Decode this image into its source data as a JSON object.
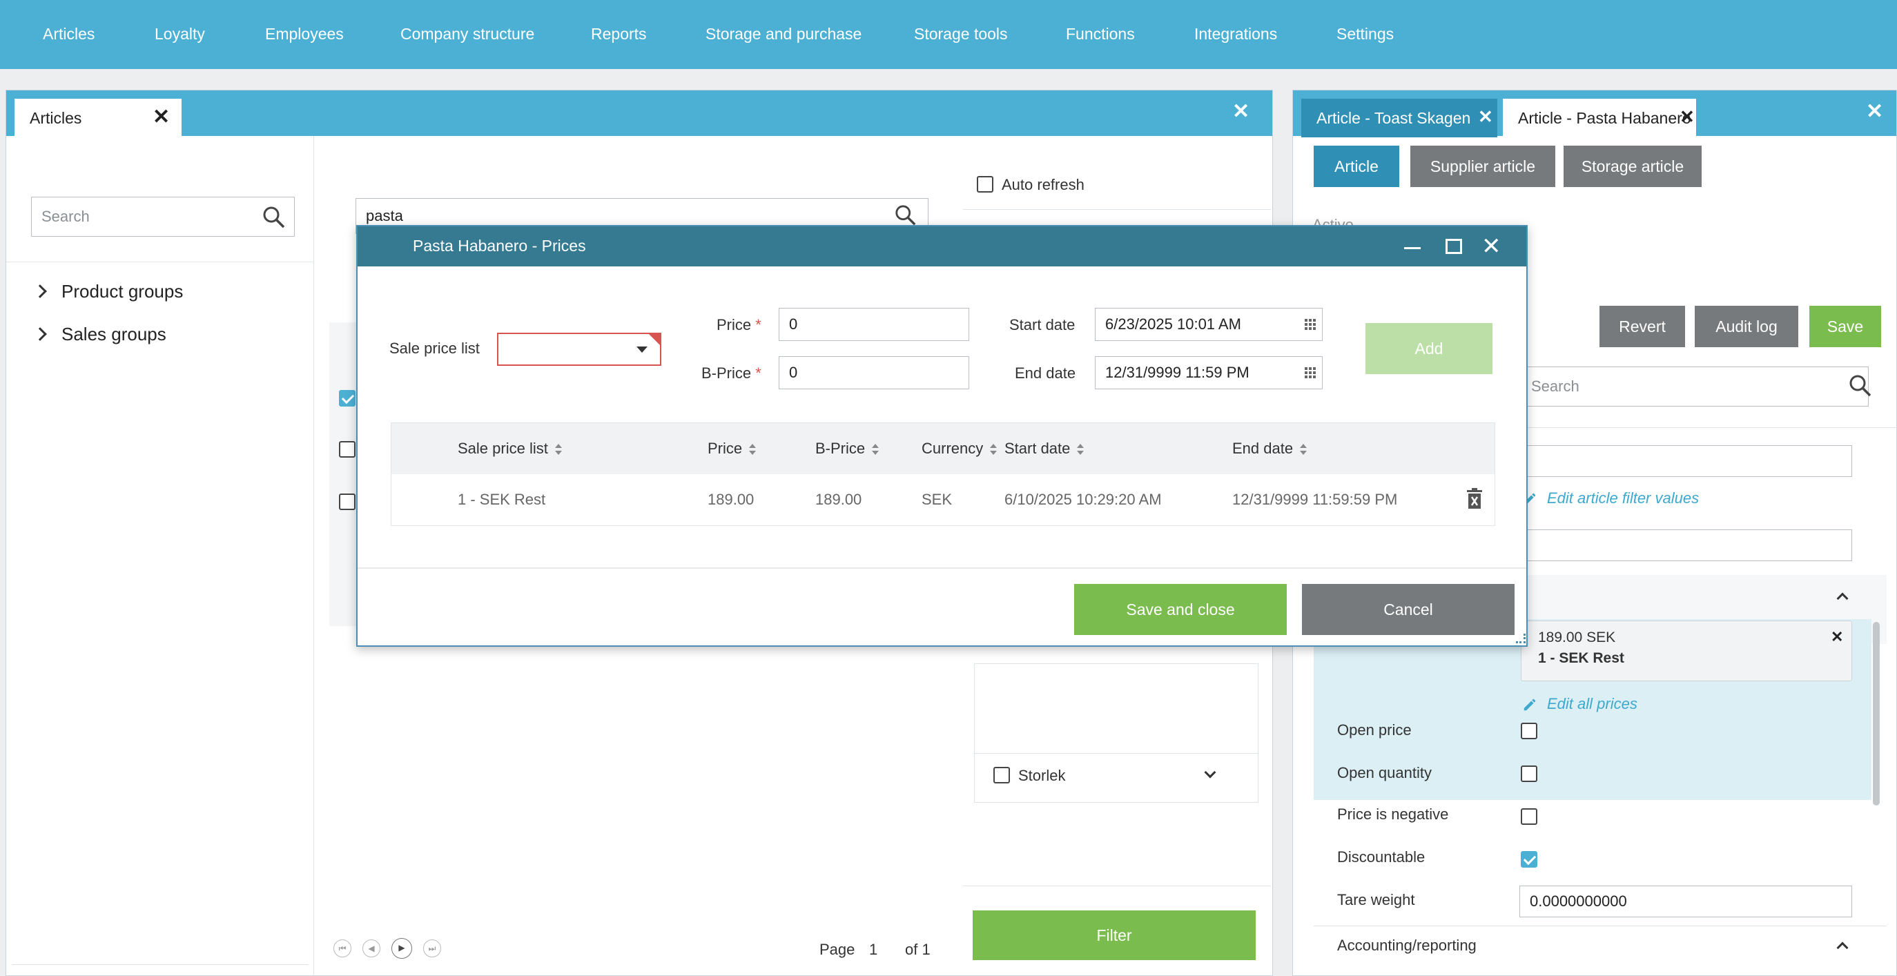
{
  "nav": {
    "items": [
      "Articles",
      "Loyalty",
      "Employees",
      "Company structure",
      "Reports",
      "Storage and purchase",
      "Storage tools",
      "Functions",
      "Integrations",
      "Settings"
    ]
  },
  "left_panel": {
    "tab_label": "Articles",
    "search_placeholder": "Search",
    "tree": [
      "Product groups",
      "Sales groups"
    ],
    "article_search_value": "pasta",
    "auto_refresh_label": "Auto refresh",
    "storlek_label": "Storlek",
    "filter_button": "Filter",
    "pager": {
      "page_label": "Page",
      "page_value": "1",
      "of_label": "of 1"
    }
  },
  "right_panel": {
    "tabs": [
      "Article - Toast Skagen",
      "Article - Pasta Habanero"
    ],
    "subtabs": [
      "Article",
      "Supplier article",
      "Storage article"
    ],
    "active_label": "Active",
    "buttons": {
      "revert": "Revert",
      "audit_log": "Audit log",
      "save": "Save"
    },
    "search_placeholder": "Search",
    "edit_filter_values": "Edit article filter values",
    "price_card": {
      "amount": "189.00 SEK",
      "list": "1 - SEK Rest"
    },
    "edit_all_prices": "Edit all prices",
    "fields": [
      {
        "label": "Open price",
        "checked": false
      },
      {
        "label": "Open quantity",
        "checked": false
      },
      {
        "label": "Price is negative",
        "checked": false
      },
      {
        "label": "Discountable",
        "checked": true
      }
    ],
    "tare_weight": {
      "label": "Tare weight",
      "value": "0.0000000000"
    },
    "accounting_label": "Accounting/reporting"
  },
  "modal": {
    "title": "Pasta Habanero - Prices",
    "form": {
      "sale_price_list_label": "Sale price list",
      "price_label": "Price",
      "price_value": "0",
      "bprice_label": "B-Price",
      "bprice_value": "0",
      "start_date_label": "Start date",
      "start_date_value": "6/23/2025 10:01 AM",
      "end_date_label": "End date",
      "end_date_value": "12/31/9999 11:59 PM",
      "required_mark": "*",
      "add_button": "Add"
    },
    "table": {
      "columns": [
        "Sale price list",
        "Price",
        "B-Price",
        "Currency",
        "Start date",
        "End date"
      ],
      "rows": [
        [
          "1 - SEK Rest",
          "189.00",
          "189.00",
          "SEK",
          "6/10/2025 10:29:20 AM",
          "12/31/9999 11:59:59 PM"
        ]
      ]
    },
    "buttons": {
      "save_close": "Save and close",
      "cancel": "Cancel"
    }
  },
  "colors": {
    "brand": "#4cb0d4",
    "modal_header": "#357a91",
    "green": "#7bbc4f",
    "grey": "#777a7c",
    "error_border": "#d9534f"
  }
}
